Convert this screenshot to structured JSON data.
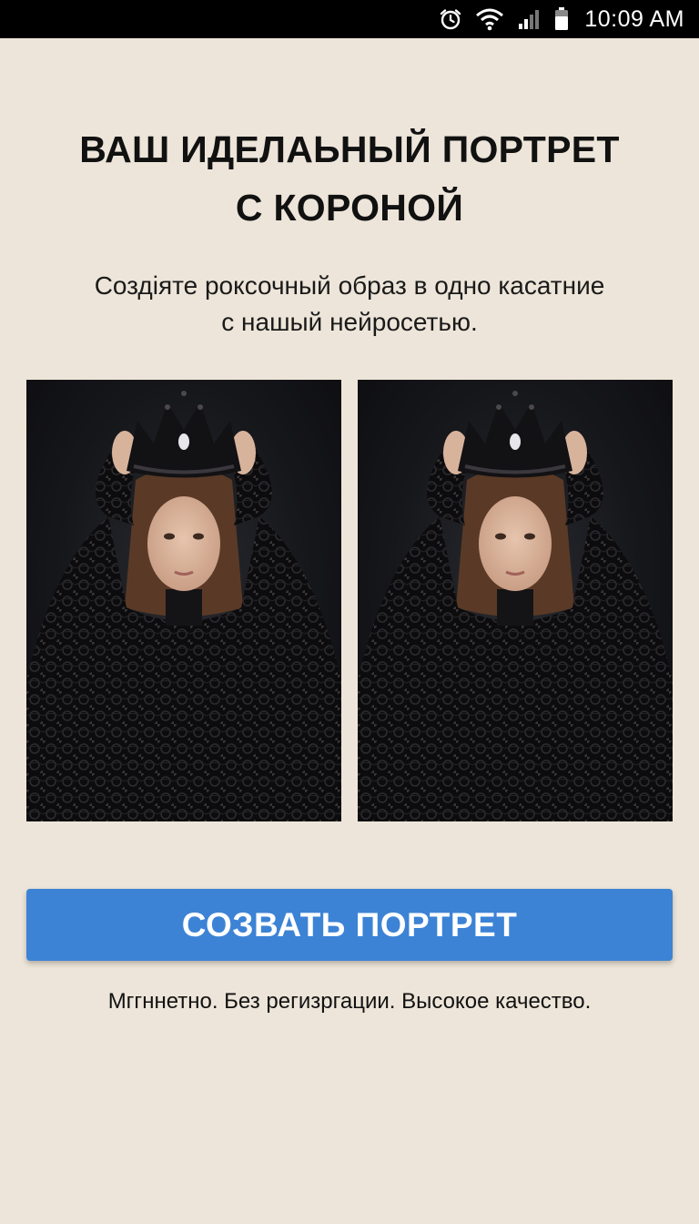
{
  "status_bar": {
    "time": "10:09 AM",
    "icons": [
      "alarm-icon",
      "wifi-icon",
      "signal-icon",
      "battery-icon"
    ]
  },
  "hero": {
    "title_line1": "ВАШ ИДЕЛАЬНЫЙ ПОРТРЕТ",
    "title_line2": "С КОРОНОЙ",
    "subtitle_line1": "Создіяте роксочный образ в одно касатние",
    "subtitle_line2": "с нашый нейросетью."
  },
  "gallery": {
    "images": [
      "portrait-crown-photo",
      "portrait-crown-photo"
    ]
  },
  "cta": {
    "label": "СОЗВАТЬ ПОРТРЕТ",
    "color": "#3c83d6"
  },
  "footnote": "Мггннетно. Без регизргации. Высокое качество.",
  "colors": {
    "background": "#ede5d9",
    "status_bar": "#000000",
    "text": "#111111"
  }
}
